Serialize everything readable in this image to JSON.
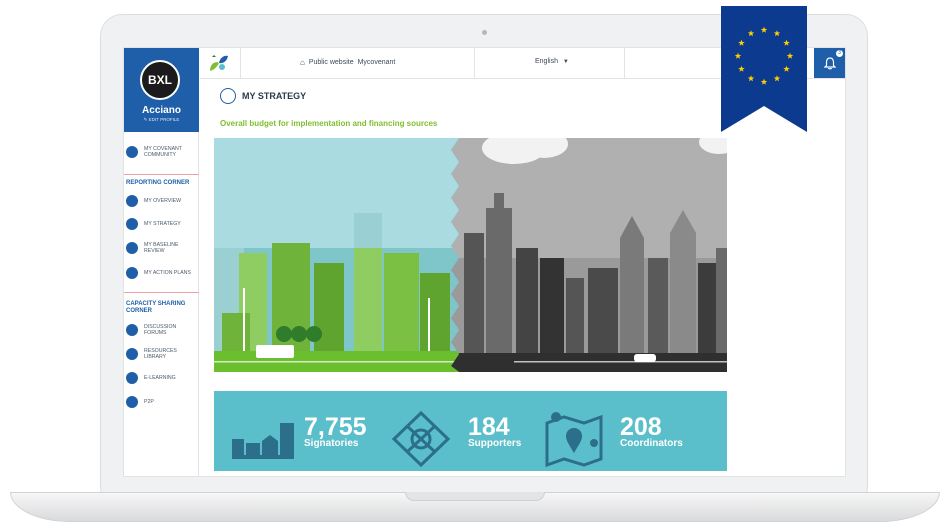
{
  "sidebar": {
    "avatar_text": "BXL",
    "city": "Acciano",
    "edit_profile": "EDIT PROFILE",
    "community": "MY COVENANT COMMUNITY",
    "reporting_head": "REPORTING CORNER",
    "reporting_items": [
      "MY OVERVIEW",
      "MY STRATEGY",
      "MY BASELINE REVIEW",
      "MY ACTION PLANS"
    ],
    "capacity_head": "CAPACITY SHARING CORNER",
    "capacity_items": [
      "DISCUSSION FORUMS",
      "RESOURCES LIBRARY",
      "E-LEARNING",
      "P2P"
    ]
  },
  "topbar": {
    "public_site": "Public website",
    "mycovenant": "Mycovenant",
    "language": "English",
    "bell_count": "3"
  },
  "main": {
    "title": "MY STRATEGY",
    "budget": "Overall  budget for implementation and financing sources"
  },
  "stats": [
    {
      "value": "7,755",
      "label": "Signatories"
    },
    {
      "value": "184",
      "label": "Supporters"
    },
    {
      "value": "208",
      "label": "Coordinators"
    }
  ],
  "colors": {
    "brand_blue": "#1f5ea8",
    "green": "#7fbf2f",
    "stats_bg": "#5bbfcb",
    "eu_blue": "#003399",
    "eu_gold": "#ffcc00"
  },
  "icons": [
    "home-icon",
    "chevron-down-icon",
    "bell-icon",
    "edit-icon",
    "strategy-icon"
  ]
}
